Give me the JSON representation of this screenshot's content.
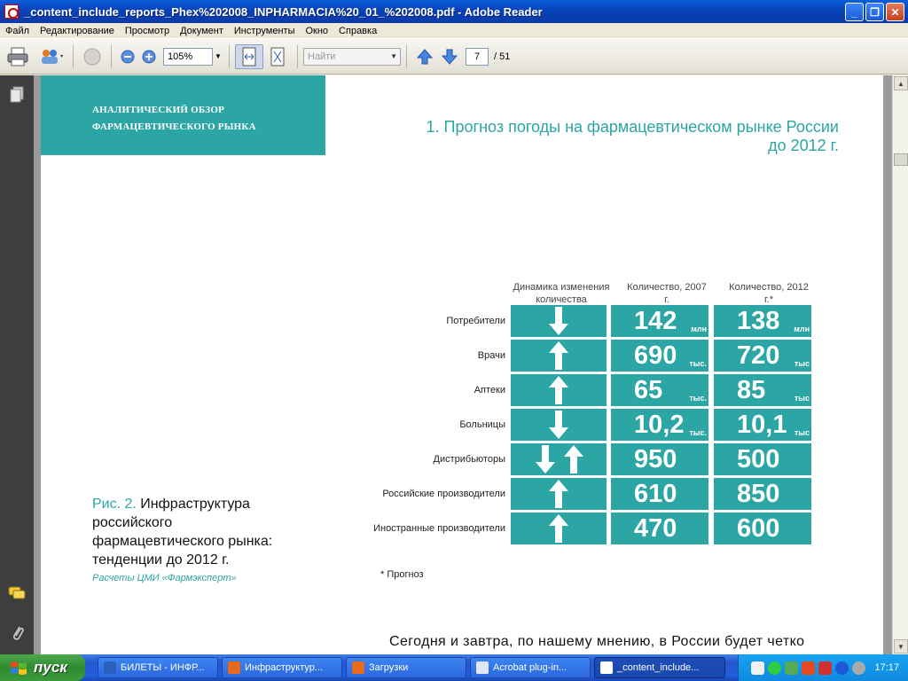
{
  "window": {
    "title": "_content_include_reports_Phex%202008_INPHARMACIA%20_01_%202008.pdf - Adobe Reader"
  },
  "menu": [
    "Файл",
    "Редактирование",
    "Просмотр",
    "Документ",
    "Инструменты",
    "Окно",
    "Справка"
  ],
  "toolbar": {
    "zoom": "105%",
    "find_placeholder": "Найти",
    "page_current": "7",
    "page_total": "/ 51"
  },
  "document": {
    "banner_line1": "АНАЛИТИЧЕСКИЙ ОБЗОР",
    "banner_line2": "ФАРМАЦЕВТИЧЕСКОГО РЫНКА",
    "heading_line1": "1. Прогноз погоды на фармацевтическом рынке России",
    "heading_line2": "до 2012 г.",
    "caption_num": "Рис. 2.",
    "caption_text": "Инфраструктура российского фармацевтического рынка: тенденции до 2012 г.",
    "source": "Расчеты ЦМИ «Фармэксперт»",
    "footnote": "* Прогноз",
    "body_text": "Сегодня и завтра, по нашему мнению, в России будет четко"
  },
  "table": {
    "col_dynamics": "Динамика изменения количества",
    "col_2007": "Количество, 2007 г.",
    "col_2012": "Количество, 2012 г.*",
    "rows": [
      {
        "label": "Потребители",
        "arrows": [
          "down"
        ],
        "v2007": "142",
        "u2007": "млн",
        "v2012": "138",
        "u2012": "млн"
      },
      {
        "label": "Врачи",
        "arrows": [
          "up"
        ],
        "v2007": "690",
        "u2007": "тыс.",
        "v2012": "720",
        "u2012": "тыс"
      },
      {
        "label": "Аптеки",
        "arrows": [
          "up"
        ],
        "v2007": "65",
        "u2007": "тыс.",
        "v2012": "85",
        "u2012": "тыс"
      },
      {
        "label": "Больницы",
        "arrows": [
          "down"
        ],
        "v2007": "10,2",
        "u2007": "тыс.",
        "v2012": "10,1",
        "u2012": "тыс"
      },
      {
        "label": "Дистрибьюторы",
        "arrows": [
          "down",
          "up"
        ],
        "v2007": "950",
        "u2007": "",
        "v2012": "500",
        "u2012": ""
      },
      {
        "label": "Российские производители",
        "arrows": [
          "up"
        ],
        "v2007": "610",
        "u2007": "",
        "v2012": "850",
        "u2012": ""
      },
      {
        "label": "Иностранные производители",
        "arrows": [
          "up"
        ],
        "v2007": "470",
        "u2007": "",
        "v2012": "600",
        "u2012": ""
      }
    ]
  },
  "taskbar": {
    "start_label": "пуск",
    "items": [
      {
        "label": "БИЛЕТЫ - ИНФР...",
        "icon": "word-icon",
        "color": "#2b5fbd"
      },
      {
        "label": "Инфраструктур...",
        "icon": "firefox-icon",
        "color": "#e86a1a"
      },
      {
        "label": "Загрузки",
        "icon": "firefox-icon",
        "color": "#e86a1a"
      },
      {
        "label": "Acrobat plug-in...",
        "icon": "window-icon",
        "color": "#dde6f6"
      },
      {
        "label": "_content_include...",
        "icon": "pdf-icon",
        "color": "#ffffff"
      }
    ],
    "clock": "17:17"
  }
}
